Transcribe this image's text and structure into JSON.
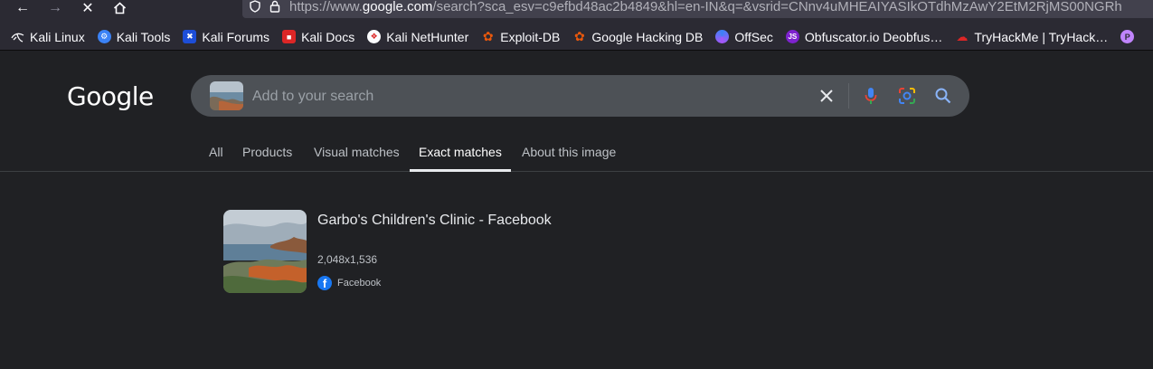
{
  "browser": {
    "url_prefix": "https://www.",
    "url_domain": "google.com",
    "url_rest": "/search?sca_esv=c9efbd48ac2b4849&hl=en-IN&q=&vsrid=CNnv4uMHEAIYASIkOTdhMzAwY2EtM2RjMS00NGRh"
  },
  "bookmarks": [
    {
      "label": "Kali Linux",
      "icon": "kali-dragon-icon",
      "color": "#2b2a33"
    },
    {
      "label": "Kali Tools",
      "icon": "kali-tools-icon",
      "color": "#3b82f6"
    },
    {
      "label": "Kali Forums",
      "icon": "kali-forums-icon",
      "color": "#3b82f6"
    },
    {
      "label": "Kali Docs",
      "icon": "kali-docs-icon",
      "color": "#dc2626"
    },
    {
      "label": "Kali NetHunter",
      "icon": "kali-nethunter-icon",
      "color": "#dc2626"
    },
    {
      "label": "Exploit-DB",
      "icon": "exploit-db-icon",
      "color": "#ea580c"
    },
    {
      "label": "Google Hacking DB",
      "icon": "ghdb-icon",
      "color": "#ea580c"
    },
    {
      "label": "OffSec",
      "icon": "offsec-icon",
      "color": "#3b82f6"
    },
    {
      "label": "Obfuscator.io Deobfus…",
      "icon": "obfuscator-icon",
      "color": "#7e22ce"
    },
    {
      "label": "TryHackMe | TryHack…",
      "icon": "tryhackme-icon",
      "color": "#dc2626"
    }
  ],
  "google": {
    "logo": "Google",
    "search_placeholder": "Add to your search"
  },
  "tabs": [
    {
      "label": "All"
    },
    {
      "label": "Products"
    },
    {
      "label": "Visual matches"
    },
    {
      "label": "Exact matches",
      "active": true
    },
    {
      "label": "About this image"
    }
  ],
  "result": {
    "title": "Garbo's Children's Clinic - Facebook",
    "dimensions": "2,048x1,536",
    "source": "Facebook"
  },
  "colors": {
    "background": "#202124",
    "searchbar": "#4d5156",
    "accent_blue": "#8ab4f8"
  }
}
